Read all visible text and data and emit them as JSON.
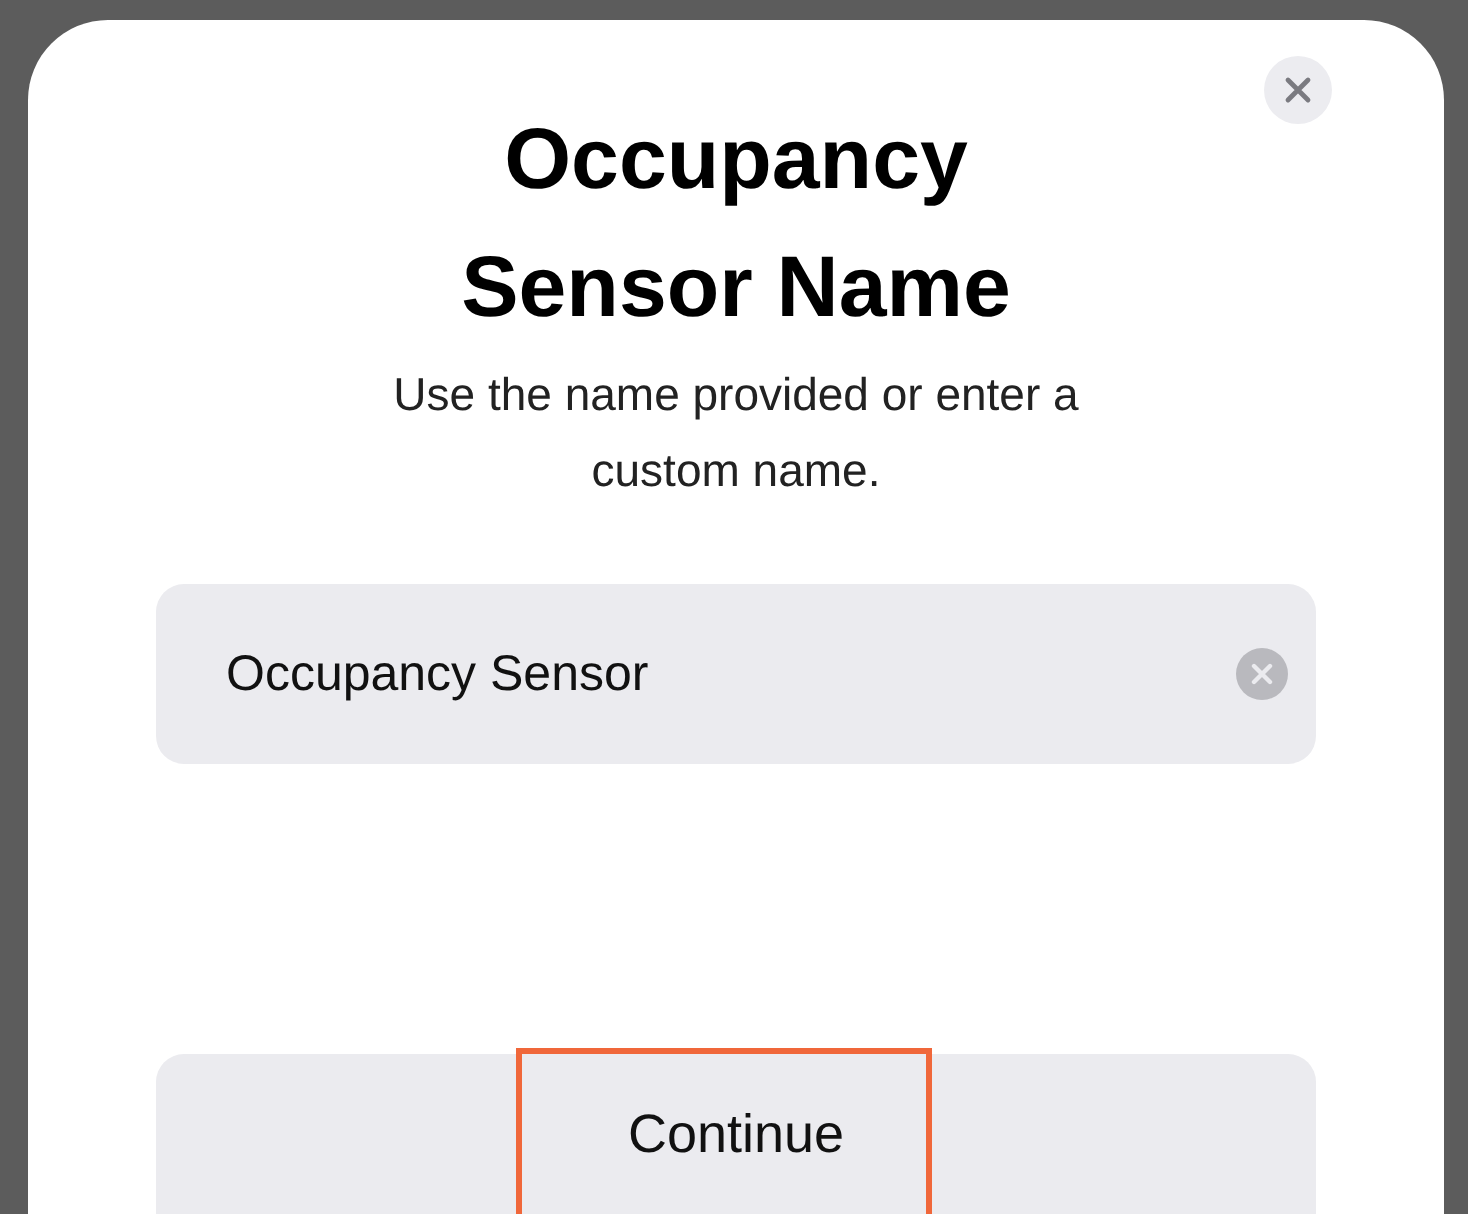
{
  "sheet": {
    "title": "Occupancy Sensor Name",
    "subtitle": "Use the name provided or enter a custom name.",
    "name_field": {
      "value": "Occupancy Sensor"
    },
    "continue_button": {
      "label": "Continue",
      "highlighted": true
    }
  }
}
